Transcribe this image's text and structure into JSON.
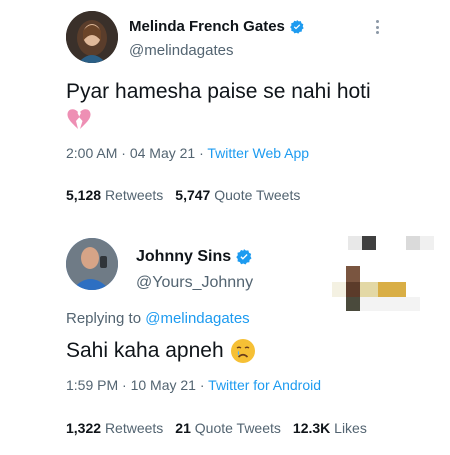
{
  "tweet1": {
    "display_name": "Melinda French Gates",
    "handle": "@melindagates",
    "body": "Pyar hamesha paise se nahi hoti",
    "emoji": "broken-heart",
    "time": "2:00 AM",
    "date": "04 May 21",
    "source": "Twitter Web App",
    "stats": {
      "retweets_count": "5,128",
      "retweets_label": "Retweets",
      "quotes_count": "5,747",
      "quotes_label": "Quote Tweets"
    }
  },
  "tweet2": {
    "display_name": "Johnny Sins",
    "handle": "@Yours_Johnny",
    "replying_label": "Replying to",
    "replying_mention": "@melindagates",
    "body": "Sahi kaha apneh",
    "emoji": "sad-face",
    "time": "1:59 PM",
    "date": "10 May 21",
    "source": "Twitter for Android",
    "stats": {
      "retweets_count": "1,322",
      "retweets_label": "Retweets",
      "quotes_count": "21",
      "quotes_label": "Quote Tweets",
      "likes_count": "12.3K",
      "likes_label": "Likes"
    }
  },
  "colors": {
    "accent": "#1d9bf0",
    "muted": "#536471",
    "text": "#0f1419"
  }
}
